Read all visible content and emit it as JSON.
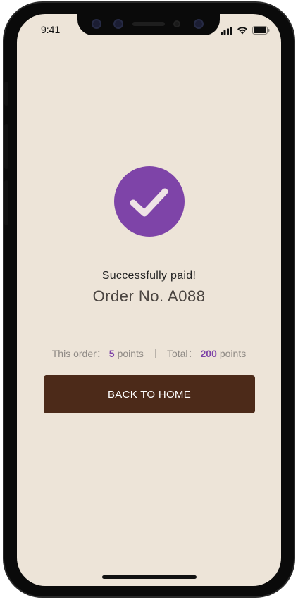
{
  "status_bar": {
    "time": "9:41",
    "icons": [
      "cellular-signal-icon",
      "wifi-icon",
      "battery-icon"
    ]
  },
  "payment": {
    "icon": "checkmark-icon",
    "title": "Successfully paid!",
    "order_number": "Order No. A088"
  },
  "points": {
    "this_order_label": "This order：",
    "this_order_value": "5",
    "this_order_unit": "points",
    "total_label": "Total：",
    "total_value": "200",
    "total_unit": "points"
  },
  "actions": {
    "back_home_label": "BACK TO HOME"
  },
  "colors": {
    "background": "#ede4d8",
    "accent": "#7e44a8",
    "button": "#4c2a19",
    "frame": "#0a0a0a"
  }
}
